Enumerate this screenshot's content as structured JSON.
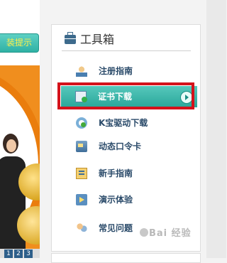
{
  "left": {
    "tip_button_label": "装提示",
    "pager": [
      "1",
      "2",
      "3"
    ]
  },
  "toolbox": {
    "title": "工具箱",
    "items": [
      {
        "label": "注册指南",
        "icon": "user-guide-icon"
      },
      {
        "label": "证书下载",
        "icon": "certificate-download-icon",
        "active": true
      },
      {
        "label": "K宝驱动下载",
        "icon": "k-bao-driver-icon"
      },
      {
        "label": "动态口令卡",
        "icon": "token-card-icon"
      },
      {
        "label": "新手指南",
        "icon": "beginner-guide-icon"
      },
      {
        "label": "演示体验",
        "icon": "demo-icon"
      },
      {
        "label": "常见问题",
        "icon": "faq-icon"
      }
    ]
  },
  "watermark": "Bai 经验",
  "colors": {
    "accent": "#2fb1a4",
    "highlight_border": "#d4121b",
    "link_text": "#2b4b6a"
  }
}
